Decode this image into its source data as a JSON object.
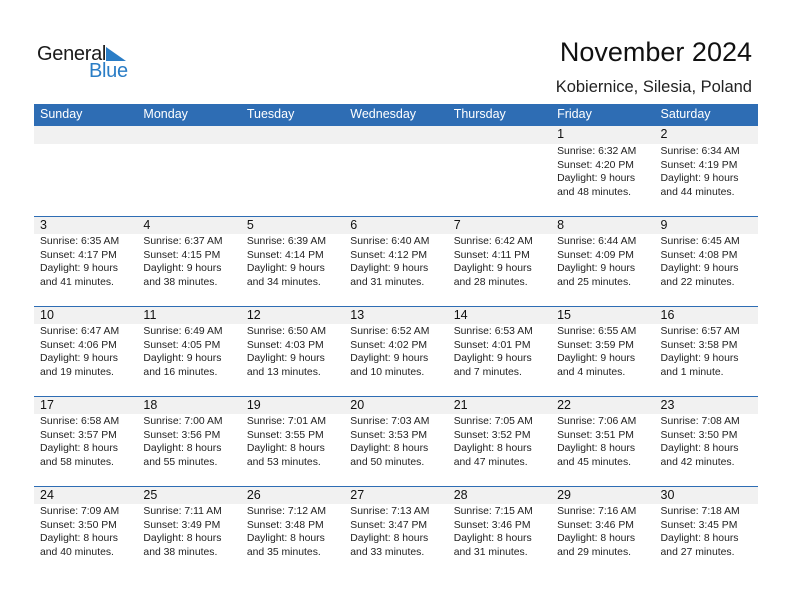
{
  "logo": {
    "line1": "General",
    "line2": "Blue"
  },
  "header": {
    "title": "November 2024",
    "location": "Kobiernice, Silesia, Poland"
  },
  "colors": {
    "header_bg": "#2e6db4",
    "date_strip": "#f1f1f1",
    "logo_blue": "#2a7dc6"
  },
  "weekdays": [
    "Sunday",
    "Monday",
    "Tuesday",
    "Wednesday",
    "Thursday",
    "Friday",
    "Saturday"
  ],
  "weeks": [
    [
      {
        "date": "",
        "sunrise": "",
        "sunset": "",
        "daylight1": "",
        "daylight2": ""
      },
      {
        "date": "",
        "sunrise": "",
        "sunset": "",
        "daylight1": "",
        "daylight2": ""
      },
      {
        "date": "",
        "sunrise": "",
        "sunset": "",
        "daylight1": "",
        "daylight2": ""
      },
      {
        "date": "",
        "sunrise": "",
        "sunset": "",
        "daylight1": "",
        "daylight2": ""
      },
      {
        "date": "",
        "sunrise": "",
        "sunset": "",
        "daylight1": "",
        "daylight2": ""
      },
      {
        "date": "1",
        "sunrise": "Sunrise: 6:32 AM",
        "sunset": "Sunset: 4:20 PM",
        "daylight1": "Daylight: 9 hours",
        "daylight2": "and 48 minutes."
      },
      {
        "date": "2",
        "sunrise": "Sunrise: 6:34 AM",
        "sunset": "Sunset: 4:19 PM",
        "daylight1": "Daylight: 9 hours",
        "daylight2": "and 44 minutes."
      }
    ],
    [
      {
        "date": "3",
        "sunrise": "Sunrise: 6:35 AM",
        "sunset": "Sunset: 4:17 PM",
        "daylight1": "Daylight: 9 hours",
        "daylight2": "and 41 minutes."
      },
      {
        "date": "4",
        "sunrise": "Sunrise: 6:37 AM",
        "sunset": "Sunset: 4:15 PM",
        "daylight1": "Daylight: 9 hours",
        "daylight2": "and 38 minutes."
      },
      {
        "date": "5",
        "sunrise": "Sunrise: 6:39 AM",
        "sunset": "Sunset: 4:14 PM",
        "daylight1": "Daylight: 9 hours",
        "daylight2": "and 34 minutes."
      },
      {
        "date": "6",
        "sunrise": "Sunrise: 6:40 AM",
        "sunset": "Sunset: 4:12 PM",
        "daylight1": "Daylight: 9 hours",
        "daylight2": "and 31 minutes."
      },
      {
        "date": "7",
        "sunrise": "Sunrise: 6:42 AM",
        "sunset": "Sunset: 4:11 PM",
        "daylight1": "Daylight: 9 hours",
        "daylight2": "and 28 minutes."
      },
      {
        "date": "8",
        "sunrise": "Sunrise: 6:44 AM",
        "sunset": "Sunset: 4:09 PM",
        "daylight1": "Daylight: 9 hours",
        "daylight2": "and 25 minutes."
      },
      {
        "date": "9",
        "sunrise": "Sunrise: 6:45 AM",
        "sunset": "Sunset: 4:08 PM",
        "daylight1": "Daylight: 9 hours",
        "daylight2": "and 22 minutes."
      }
    ],
    [
      {
        "date": "10",
        "sunrise": "Sunrise: 6:47 AM",
        "sunset": "Sunset: 4:06 PM",
        "daylight1": "Daylight: 9 hours",
        "daylight2": "and 19 minutes."
      },
      {
        "date": "11",
        "sunrise": "Sunrise: 6:49 AM",
        "sunset": "Sunset: 4:05 PM",
        "daylight1": "Daylight: 9 hours",
        "daylight2": "and 16 minutes."
      },
      {
        "date": "12",
        "sunrise": "Sunrise: 6:50 AM",
        "sunset": "Sunset: 4:03 PM",
        "daylight1": "Daylight: 9 hours",
        "daylight2": "and 13 minutes."
      },
      {
        "date": "13",
        "sunrise": "Sunrise: 6:52 AM",
        "sunset": "Sunset: 4:02 PM",
        "daylight1": "Daylight: 9 hours",
        "daylight2": "and 10 minutes."
      },
      {
        "date": "14",
        "sunrise": "Sunrise: 6:53 AM",
        "sunset": "Sunset: 4:01 PM",
        "daylight1": "Daylight: 9 hours",
        "daylight2": "and 7 minutes."
      },
      {
        "date": "15",
        "sunrise": "Sunrise: 6:55 AM",
        "sunset": "Sunset: 3:59 PM",
        "daylight1": "Daylight: 9 hours",
        "daylight2": "and 4 minutes."
      },
      {
        "date": "16",
        "sunrise": "Sunrise: 6:57 AM",
        "sunset": "Sunset: 3:58 PM",
        "daylight1": "Daylight: 9 hours",
        "daylight2": "and 1 minute."
      }
    ],
    [
      {
        "date": "17",
        "sunrise": "Sunrise: 6:58 AM",
        "sunset": "Sunset: 3:57 PM",
        "daylight1": "Daylight: 8 hours",
        "daylight2": "and 58 minutes."
      },
      {
        "date": "18",
        "sunrise": "Sunrise: 7:00 AM",
        "sunset": "Sunset: 3:56 PM",
        "daylight1": "Daylight: 8 hours",
        "daylight2": "and 55 minutes."
      },
      {
        "date": "19",
        "sunrise": "Sunrise: 7:01 AM",
        "sunset": "Sunset: 3:55 PM",
        "daylight1": "Daylight: 8 hours",
        "daylight2": "and 53 minutes."
      },
      {
        "date": "20",
        "sunrise": "Sunrise: 7:03 AM",
        "sunset": "Sunset: 3:53 PM",
        "daylight1": "Daylight: 8 hours",
        "daylight2": "and 50 minutes."
      },
      {
        "date": "21",
        "sunrise": "Sunrise: 7:05 AM",
        "sunset": "Sunset: 3:52 PM",
        "daylight1": "Daylight: 8 hours",
        "daylight2": "and 47 minutes."
      },
      {
        "date": "22",
        "sunrise": "Sunrise: 7:06 AM",
        "sunset": "Sunset: 3:51 PM",
        "daylight1": "Daylight: 8 hours",
        "daylight2": "and 45 minutes."
      },
      {
        "date": "23",
        "sunrise": "Sunrise: 7:08 AM",
        "sunset": "Sunset: 3:50 PM",
        "daylight1": "Daylight: 8 hours",
        "daylight2": "and 42 minutes."
      }
    ],
    [
      {
        "date": "24",
        "sunrise": "Sunrise: 7:09 AM",
        "sunset": "Sunset: 3:50 PM",
        "daylight1": "Daylight: 8 hours",
        "daylight2": "and 40 minutes."
      },
      {
        "date": "25",
        "sunrise": "Sunrise: 7:11 AM",
        "sunset": "Sunset: 3:49 PM",
        "daylight1": "Daylight: 8 hours",
        "daylight2": "and 38 minutes."
      },
      {
        "date": "26",
        "sunrise": "Sunrise: 7:12 AM",
        "sunset": "Sunset: 3:48 PM",
        "daylight1": "Daylight: 8 hours",
        "daylight2": "and 35 minutes."
      },
      {
        "date": "27",
        "sunrise": "Sunrise: 7:13 AM",
        "sunset": "Sunset: 3:47 PM",
        "daylight1": "Daylight: 8 hours",
        "daylight2": "and 33 minutes."
      },
      {
        "date": "28",
        "sunrise": "Sunrise: 7:15 AM",
        "sunset": "Sunset: 3:46 PM",
        "daylight1": "Daylight: 8 hours",
        "daylight2": "and 31 minutes."
      },
      {
        "date": "29",
        "sunrise": "Sunrise: 7:16 AM",
        "sunset": "Sunset: 3:46 PM",
        "daylight1": "Daylight: 8 hours",
        "daylight2": "and 29 minutes."
      },
      {
        "date": "30",
        "sunrise": "Sunrise: 7:18 AM",
        "sunset": "Sunset: 3:45 PM",
        "daylight1": "Daylight: 8 hours",
        "daylight2": "and 27 minutes."
      }
    ]
  ]
}
